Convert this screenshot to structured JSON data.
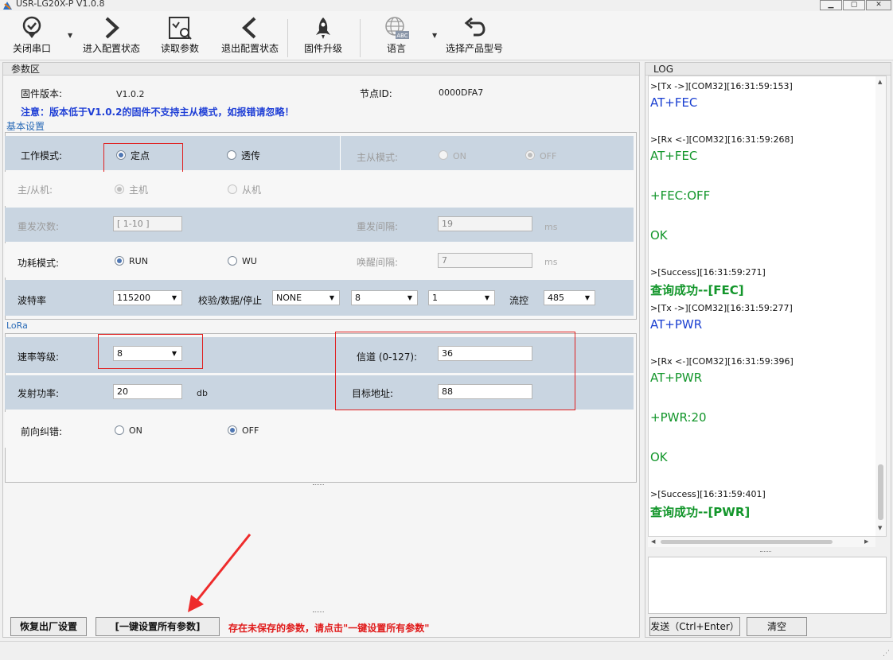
{
  "window": {
    "title": "USR-LG20X-P  V1.0.8",
    "min": "▁",
    "max": "▢",
    "close": "✕"
  },
  "toolbar": {
    "close_port": "关闭串口",
    "enter_config": "进入配置状态",
    "read_params": "读取参数",
    "exit_config": "退出配置状态",
    "firmware_upgrade": "固件升级",
    "language": "语言",
    "select_model": "选择产品型号",
    "abc": "ABC"
  },
  "params": {
    "section_title": "参数区",
    "fw_label": "固件版本:",
    "fw_value": "V1.0.2",
    "node_label": "节点ID:",
    "node_value": "0000DFA7",
    "notice": "注意：版本低于V1.0.2的固件不支持主从模式，如报错请忽略！",
    "basic_title": "基本设置",
    "work_mode_label": "工作模式:",
    "work_mode_fixed": "定点",
    "work_mode_transparent": "透传",
    "ms_mode_label": "主从模式:",
    "ms_on": "ON",
    "ms_off": "OFF",
    "master_slave_label": "主/从机:",
    "master": "主机",
    "slave": "从机",
    "retry_label": "重发次数:",
    "retry_value": "[ 1-10 ]",
    "retry_interval_label": "重发间隔:",
    "retry_interval_value": "19",
    "ms1": "ms",
    "power_mode_label": "功耗模式:",
    "run": "RUN",
    "wu": "WU",
    "wake_label": "唤醒间隔:",
    "wake_value": "7",
    "ms2": "ms",
    "baud_label": "波特率",
    "baud_value": "115200",
    "parity_label": "校验/数据/停止",
    "parity_value": "NONE",
    "data_bits": "8",
    "stop_bits": "1",
    "flow_label": "流控",
    "flow_value": "485"
  },
  "lora": {
    "title": "LoRa",
    "rate_label": "速率等级:",
    "rate_value": "8",
    "channel_label": "信道 (0-127):",
    "channel_value": "36",
    "tx_power_label": "发射功率:",
    "tx_power_value": "20",
    "db": "db",
    "target_label": "目标地址:",
    "target_value": "88",
    "fec_label": "前向纠错:",
    "fec_on": "ON",
    "fec_off": "OFF"
  },
  "bottom": {
    "restore": "恢复出厂设置",
    "set_all": "[一键设置所有参数]",
    "warning": "存在未保存的参数，请点击\"一键设置所有参数\""
  },
  "log": {
    "title": "LOG",
    "lines": [
      {
        "t": ">[Tx ->][COM32][16:31:59:153]",
        "k": "meta"
      },
      {
        "t": "AT+FEC",
        "k": "tx"
      },
      {
        "t": ">[Rx <-][COM32][16:31:59:268]",
        "k": "meta"
      },
      {
        "t": "AT+FEC",
        "k": "rx"
      },
      {
        "t": "+FEC:OFF",
        "k": "rx"
      },
      {
        "t": "OK",
        "k": "rx"
      },
      {
        "t": ">[Success][16:31:59:271]",
        "k": "meta"
      },
      {
        "t": "查询成功--[FEC]",
        "k": "ok"
      },
      {
        "t": ">[Tx ->][COM32][16:31:59:277]",
        "k": "meta"
      },
      {
        "t": "AT+PWR",
        "k": "tx"
      },
      {
        "t": ">[Rx <-][COM32][16:31:59:396]",
        "k": "meta"
      },
      {
        "t": "AT+PWR",
        "k": "rx"
      },
      {
        "t": "+PWR:20",
        "k": "rx"
      },
      {
        "t": "OK",
        "k": "rx"
      },
      {
        "t": ">[Success][16:31:59:401]",
        "k": "meta"
      },
      {
        "t": "查询成功--[PWR]",
        "k": "ok"
      }
    ],
    "send": "发送（Ctrl+Enter）",
    "clear": "清空"
  }
}
